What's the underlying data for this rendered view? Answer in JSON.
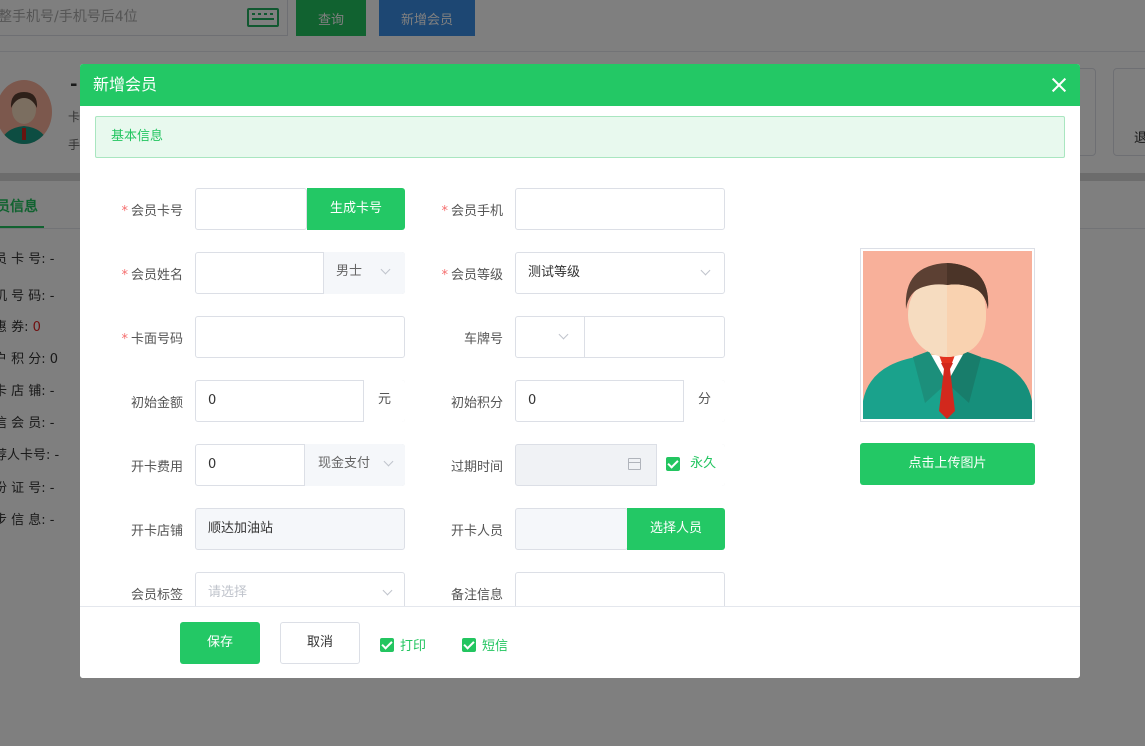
{
  "background": {
    "search": {
      "placeholder": "整手机号/手机号后4位"
    },
    "query_button": "查询",
    "add_member_button": "新增会员",
    "member_dash": "-",
    "member_lines": [
      "卡",
      "手"
    ],
    "card_label": "退",
    "tab_label": "员信息",
    "info_rows": [
      {
        "label": "员 卡 号:",
        "value": "-"
      },
      {
        "label": "机 号 码:",
        "value": "-"
      },
      {
        "label": "惠  券:",
        "value": "0"
      },
      {
        "label": "户 积 分:",
        "value": "0"
      },
      {
        "label": "卡 店 铺:",
        "value": "-"
      },
      {
        "label": "信 会 员:",
        "value": "-"
      },
      {
        "label": "荐人卡号:",
        "value": "-"
      },
      {
        "label": "份 证 号:",
        "value": "-"
      },
      {
        "label": "步 信 息:",
        "value": "-"
      }
    ]
  },
  "modal": {
    "title": "新增会员",
    "section_title": "基本信息",
    "fields": {
      "card_no": {
        "label": "会员卡号",
        "value": "",
        "action": "生成卡号"
      },
      "phone": {
        "label": "会员手机",
        "value": ""
      },
      "name": {
        "label": "会员姓名",
        "value": "",
        "gender": "男士"
      },
      "level": {
        "label": "会员等级",
        "value": "测试等级"
      },
      "face_no": {
        "label": "卡面号码",
        "value": ""
      },
      "plate": {
        "label": "车牌号",
        "prefix": "",
        "value": ""
      },
      "init_amount": {
        "label": "初始金额",
        "value": "0",
        "unit": "元"
      },
      "init_points": {
        "label": "初始积分",
        "value": "0",
        "unit": "分"
      },
      "fee": {
        "label": "开卡费用",
        "value": "0",
        "pay_method": "现金支付"
      },
      "expire": {
        "label": "过期时间",
        "value": "",
        "forever_label": "永久",
        "forever_checked": true
      },
      "store": {
        "label": "开卡店铺",
        "value": "顺达加油站"
      },
      "staff": {
        "label": "开卡人员",
        "value": "",
        "action": "选择人员"
      },
      "tags": {
        "label": "会员标签",
        "placeholder": "请选择"
      },
      "remark": {
        "label": "备注信息",
        "value": ""
      }
    },
    "upload_button": "点击上传图片",
    "footer": {
      "save": "保存",
      "cancel": "取消",
      "print": {
        "label": "打印",
        "checked": true
      },
      "sms": {
        "label": "短信",
        "checked": true
      }
    }
  },
  "colors": {
    "primary_green": "#23c865",
    "blue_button": "#3a8ee6",
    "required_star": "#f56c6c",
    "avatar_bg": "#f8b09a"
  }
}
